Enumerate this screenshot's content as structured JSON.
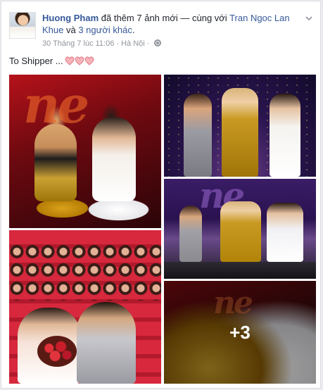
{
  "post": {
    "author": "Huong Pham",
    "action_text": " đã thêm 7 ảnh mới — cùng với ",
    "tagged_person": "Tran Ngoc Lan Khue",
    "and_text": " và ",
    "others_link": "3 người khác",
    "period": ".",
    "timestamp": "30 Tháng 7 lúc 11:06",
    "separator": " · ",
    "location": "Hà Nội",
    "privacy_icon": "globe-icon",
    "options_icon": "chevron-down-icon",
    "caption": "To Shipper ...",
    "caption_emoji": [
      "heart",
      "heart",
      "heart"
    ],
    "more_photos_label": "+3"
  },
  "colors": {
    "link": "#365899",
    "heart": "#f4a0a8",
    "meta": "#90949c"
  }
}
